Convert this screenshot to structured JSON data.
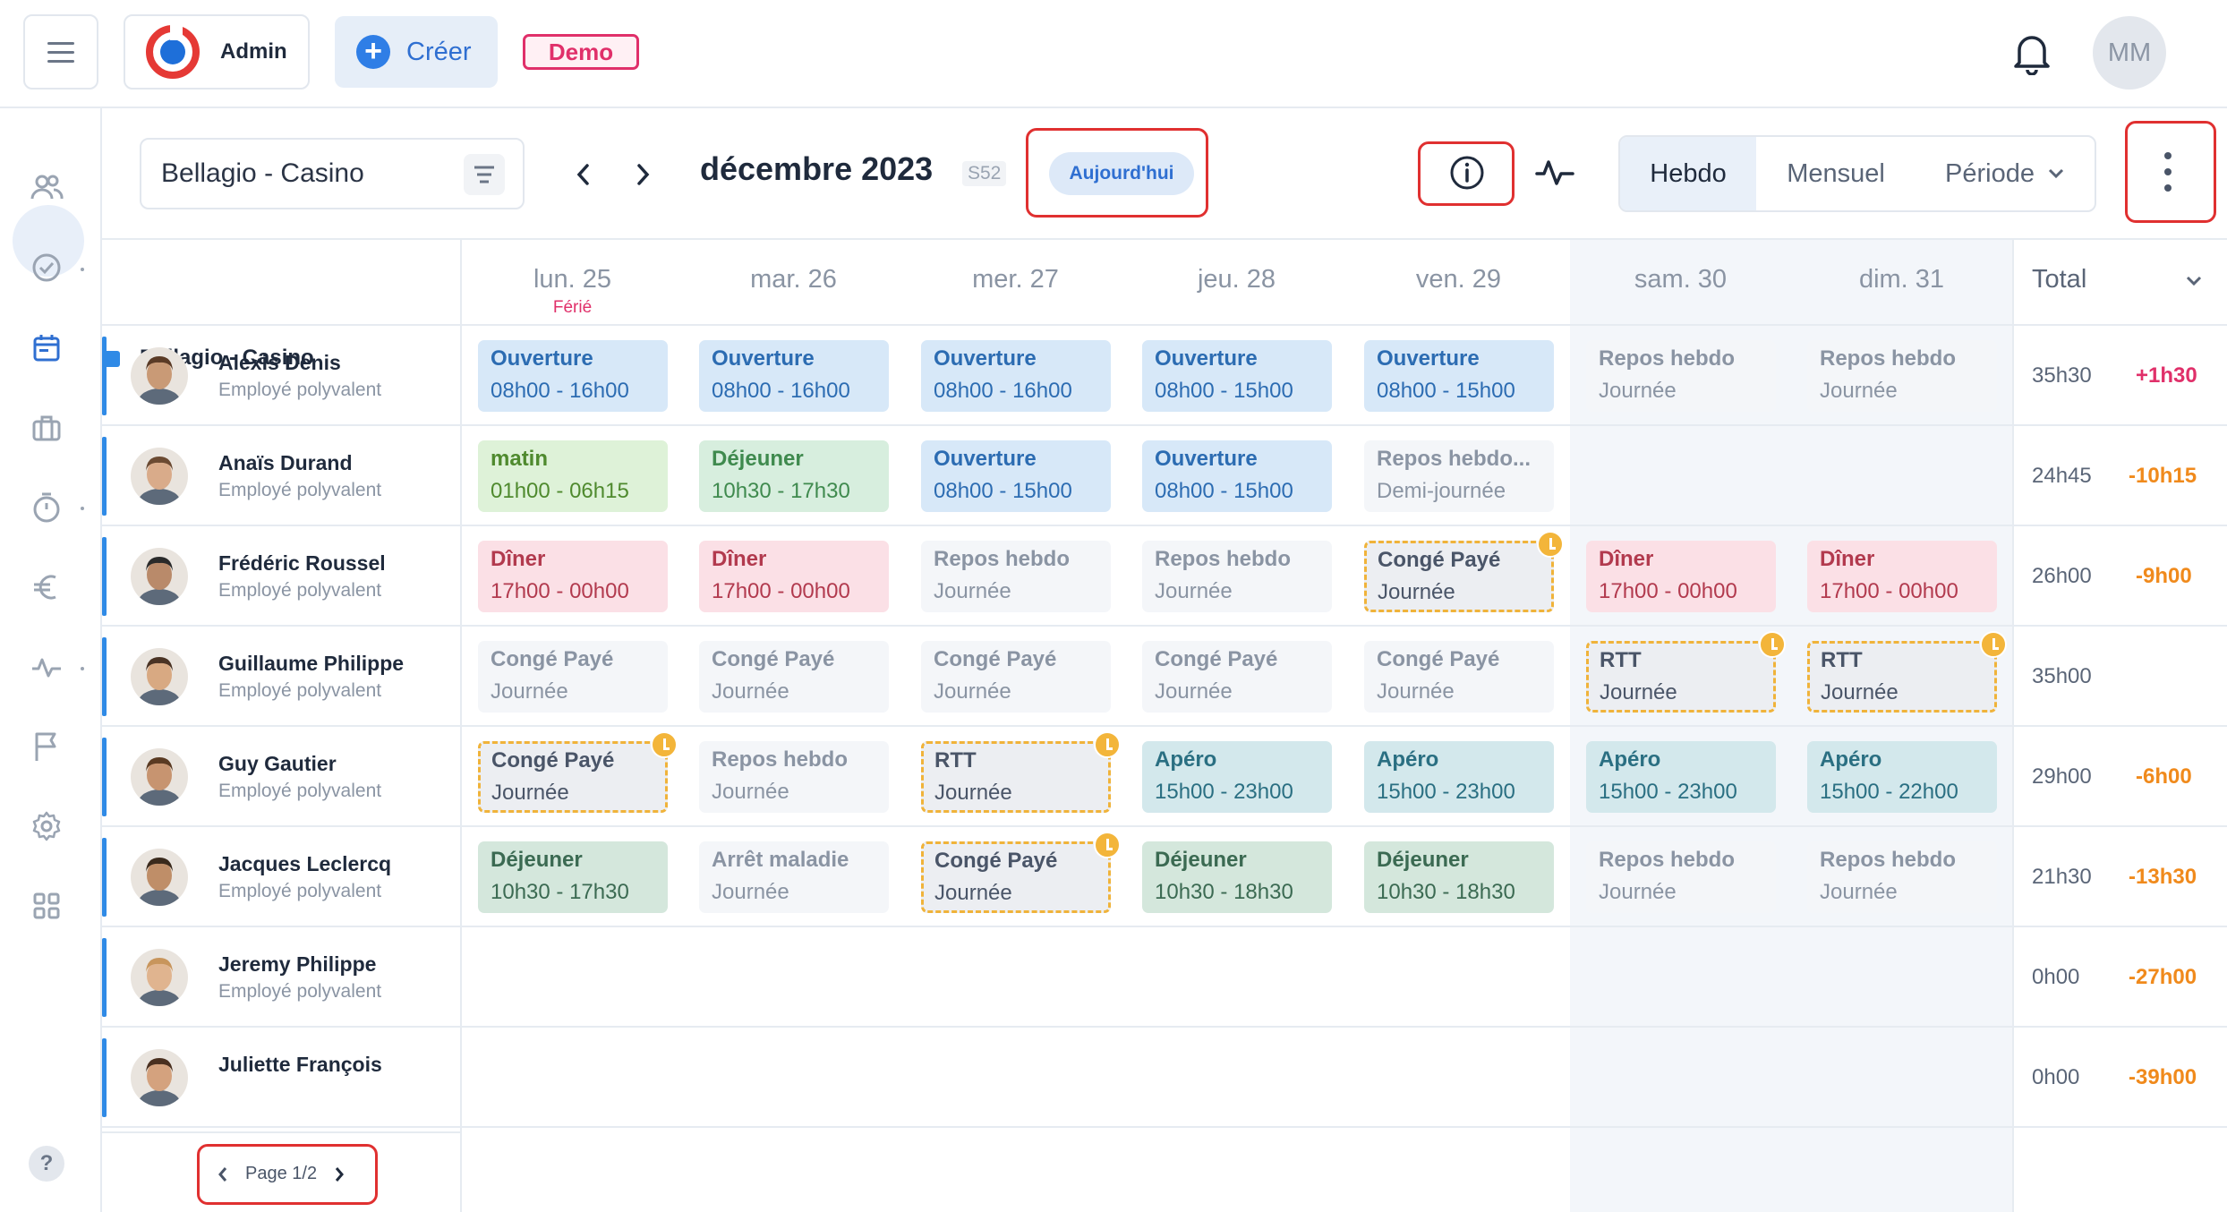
{
  "header": {
    "admin_label": "Admin",
    "create_label": "Créer",
    "demo_label": "Demo",
    "user_initials": "MM"
  },
  "toolbar": {
    "site_name": "Bellagio - Casino",
    "month_title": "décembre 2023",
    "week_badge": "S52",
    "today_label": "Aujourd'hui",
    "views": [
      "Hebdo",
      "Mensuel",
      "Période"
    ]
  },
  "days": [
    {
      "label": "lun.  25",
      "note": "Férié"
    },
    {
      "label": "mar.  26",
      "note": ""
    },
    {
      "label": "mer.  27",
      "note": ""
    },
    {
      "label": "jeu.  28",
      "note": ""
    },
    {
      "label": "ven.  29",
      "note": ""
    },
    {
      "label": "sam.  30",
      "note": ""
    },
    {
      "label": "dim.  31",
      "note": ""
    }
  ],
  "total_header": "Total",
  "group_name": "Bellagio - Casino",
  "employees": [
    {
      "name": "Alexis Denis",
      "role": "Employé polyvalent",
      "total": "35h30",
      "diff": "+1h30",
      "shifts": [
        {
          "title": "Ouverture",
          "sub": "08h00 - 16h00"
        },
        {
          "title": "Ouverture",
          "sub": "08h00 - 16h00"
        },
        {
          "title": "Ouverture",
          "sub": "08h00 - 16h00"
        },
        {
          "title": "Ouverture",
          "sub": "08h00 - 15h00"
        },
        {
          "title": "Ouverture",
          "sub": "08h00 - 15h00"
        },
        {
          "title": "Repos hebdo",
          "sub": "Journée"
        },
        {
          "title": "Repos hebdo",
          "sub": "Journée"
        }
      ]
    },
    {
      "name": "Anaïs Durand",
      "role": "Employé polyvalent",
      "total": "24h45",
      "diff": "-10h15",
      "shifts": [
        {
          "title": "matin",
          "sub": "01h00 - 06h15"
        },
        {
          "title": "Déjeuner",
          "sub": "10h30 - 17h30"
        },
        {
          "title": "Ouverture",
          "sub": "08h00 - 15h00"
        },
        {
          "title": "Ouverture",
          "sub": "08h00 - 15h00"
        },
        {
          "title": "Repos hebdo...",
          "sub": "Demi-journée"
        },
        null,
        null
      ]
    },
    {
      "name": "Frédéric Roussel",
      "role": "Employé polyvalent",
      "total": "26h00",
      "diff": "-9h00",
      "shifts": [
        {
          "title": "Dîner",
          "sub": "17h00 - 00h00"
        },
        {
          "title": "Dîner",
          "sub": "17h00 - 00h00"
        },
        {
          "title": "Repos hebdo",
          "sub": "Journée"
        },
        {
          "title": "Repos hebdo",
          "sub": "Journée"
        },
        {
          "title": "Congé Payé",
          "sub": "Journée"
        },
        {
          "title": "Dîner",
          "sub": "17h00 - 00h00"
        },
        {
          "title": "Dîner",
          "sub": "17h00 - 00h00"
        }
      ]
    },
    {
      "name": "Guillaume Philippe",
      "role": "Employé polyvalent",
      "total": "35h00",
      "diff": "",
      "shifts": [
        {
          "title": "Congé Payé",
          "sub": "Journée"
        },
        {
          "title": "Congé Payé",
          "sub": "Journée"
        },
        {
          "title": "Congé Payé",
          "sub": "Journée"
        },
        {
          "title": "Congé Payé",
          "sub": "Journée"
        },
        {
          "title": "Congé Payé",
          "sub": "Journée"
        },
        {
          "title": "RTT",
          "sub": "Journée"
        },
        {
          "title": "RTT",
          "sub": "Journée"
        }
      ]
    },
    {
      "name": "Guy Gautier",
      "role": "Employé polyvalent",
      "total": "29h00",
      "diff": "-6h00",
      "shifts": [
        {
          "title": "Congé Payé",
          "sub": "Journée"
        },
        {
          "title": "Repos hebdo",
          "sub": "Journée"
        },
        {
          "title": "RTT",
          "sub": "Journée"
        },
        {
          "title": "Apéro",
          "sub": "15h00 - 23h00"
        },
        {
          "title": "Apéro",
          "sub": "15h00 - 23h00"
        },
        {
          "title": "Apéro",
          "sub": "15h00 - 23h00"
        },
        {
          "title": "Apéro",
          "sub": "15h00 - 22h00"
        }
      ]
    },
    {
      "name": "Jacques Leclercq",
      "role": "Employé polyvalent",
      "total": "21h30",
      "diff": "-13h30",
      "shifts": [
        {
          "title": "Déjeuner",
          "sub": "10h30 - 17h30"
        },
        {
          "title": "Arrêt maladie",
          "sub": "Journée"
        },
        {
          "title": "Congé Payé",
          "sub": "Journée"
        },
        {
          "title": "Déjeuner",
          "sub": "10h30 - 18h30"
        },
        {
          "title": "Déjeuner",
          "sub": "10h30 - 18h30"
        },
        {
          "title": "Repos hebdo",
          "sub": "Journée"
        },
        {
          "title": "Repos hebdo",
          "sub": "Journée"
        }
      ]
    },
    {
      "name": "Jeremy Philippe",
      "role": "Employé polyvalent",
      "total": "0h00",
      "diff": "-27h00",
      "shifts": [
        null,
        null,
        null,
        null,
        null,
        null,
        null
      ]
    },
    {
      "name": "Juliette François",
      "role": "",
      "total": "0h00",
      "diff": "-39h00",
      "shifts": [
        null,
        null,
        null,
        null,
        null,
        null,
        null
      ]
    }
  ],
  "pager": {
    "label": "Page 1/2"
  },
  "colors": {
    "accent": "#2f7ee6",
    "positive": "#e0306a",
    "negative": "#f08a1c",
    "pending": "#f0b33a"
  }
}
